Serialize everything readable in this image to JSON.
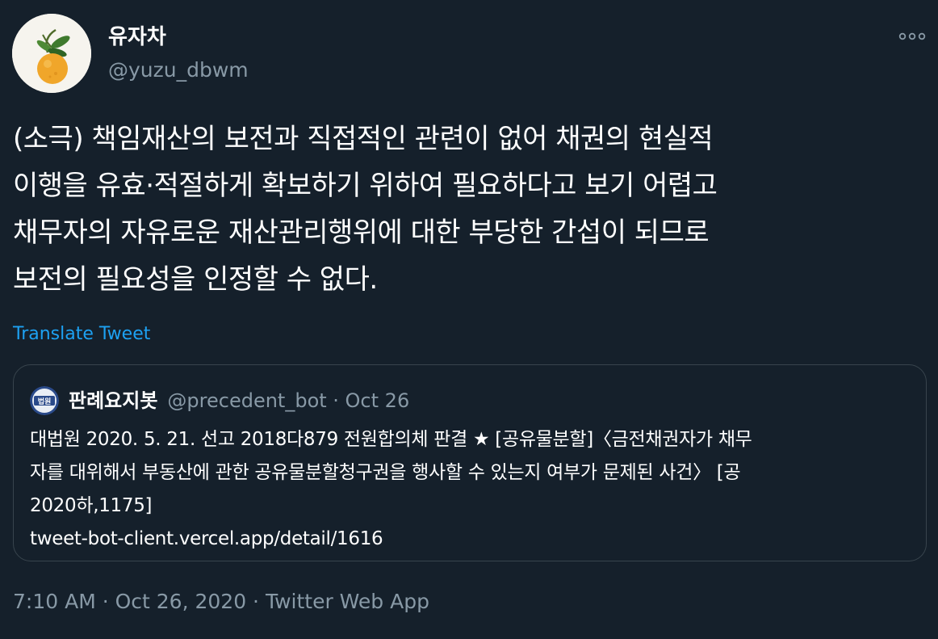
{
  "user": {
    "display_name": "유자차",
    "handle": "@yuzu_dbwm",
    "avatar_icon": "yuzu-fruit-avatar"
  },
  "more_icon": "more-horizontal-icon",
  "tweet": {
    "text_lines": [
      "(소극) 책임재산의 보전과 직접적인 관련이 없어 채권의 현실적",
      "이행을 유효·적절하게 확보하기 위하여 필요하다고 보기 어렵고",
      "채무자의 자유로운 재산관리행위에 대한 부당한 간섭이 되므로",
      "보전의 필요성을 인정할 수 없다."
    ],
    "translate_label": "Translate Tweet"
  },
  "quote": {
    "name": "판례요지봇",
    "meta": "@precedent_bot · Oct 26",
    "avatar_icon": "court-seal-avatar",
    "avatar_label": "법원",
    "body_lines": [
      "대법원 2020. 5. 21. 선고 2018다879 전원합의체 판결 ★ [공유물분할]〈금전채권자가 채무",
      "자를 대위해서 부동산에 관한 공유물분할청구권을 행사할 수 있는지 여부가 문제된 사건〉 [공",
      "2020하,1175]",
      "tweet-bot-client.vercel.app/detail/1616"
    ]
  },
  "footer": {
    "timestamp": "7:10 AM · Oct 26, 2020 · Twitter Web App"
  },
  "colors": {
    "background": "#15202b",
    "text_primary": "#ffffff",
    "text_secondary": "#8899a6",
    "link": "#1da1f2",
    "border": "#38444d"
  }
}
